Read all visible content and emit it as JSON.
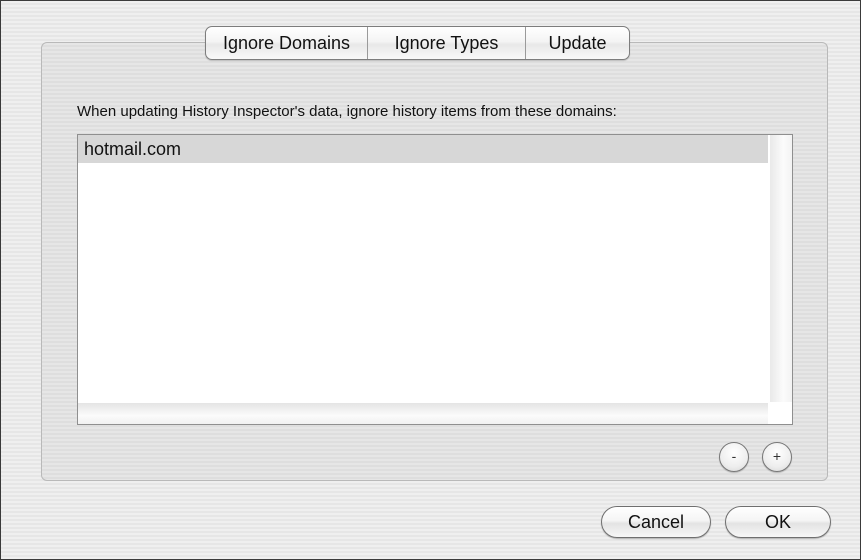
{
  "tabs": [
    {
      "label": "Ignore Domains"
    },
    {
      "label": "Ignore Types"
    },
    {
      "label": "Update"
    }
  ],
  "description": "When updating History Inspector's data, ignore history items from these domains:",
  "domains": [
    {
      "label": "hotmail.com",
      "selected": true
    }
  ],
  "controls": {
    "remove_label": "-",
    "add_label": "+",
    "remove_icon": "minus-icon",
    "add_icon": "plus-icon"
  },
  "buttons": {
    "cancel": "Cancel",
    "ok": "OK"
  }
}
